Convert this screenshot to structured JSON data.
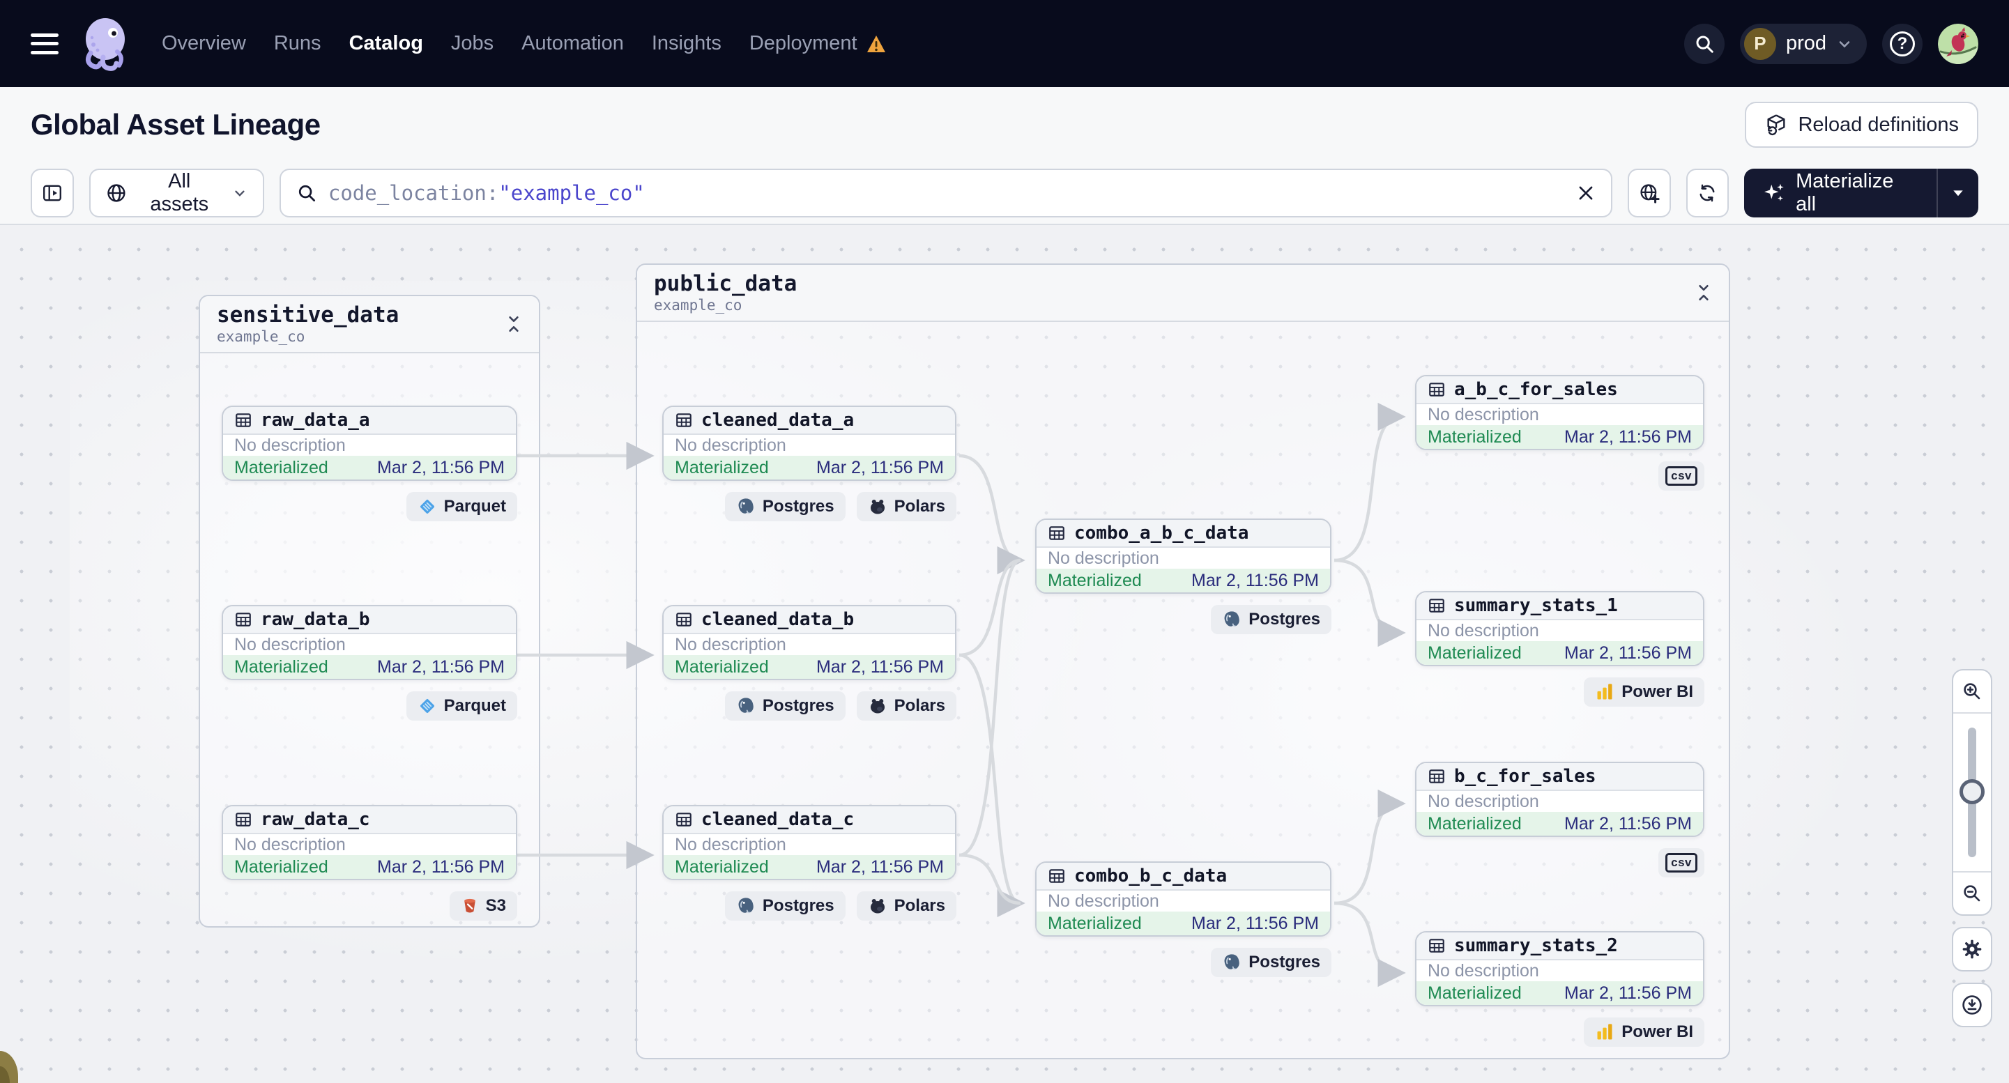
{
  "nav": {
    "items": [
      "Overview",
      "Runs",
      "Catalog",
      "Jobs",
      "Automation",
      "Insights",
      "Deployment"
    ],
    "active_item": "Catalog",
    "deployment_warning": true,
    "environment": {
      "initial": "P",
      "name": "prod"
    }
  },
  "page": {
    "title": "Global Asset Lineage",
    "reload_button_label": "Reload definitions"
  },
  "toolbar": {
    "scope_selector_label": "All assets",
    "search_tokens": [
      {
        "text": "code_location:",
        "color": "#7B83A0"
      },
      {
        "text": "\"example_co\"",
        "color": "#4A45CC"
      }
    ],
    "materialize_button_label": "Materialize all"
  },
  "graph": {
    "groups": [
      {
        "id": "sensitive_data",
        "title": "sensitive_data",
        "subtitle": "example_co"
      },
      {
        "id": "public_data",
        "title": "public_data",
        "subtitle": "example_co"
      }
    ],
    "nodes": [
      {
        "id": "raw_data_a",
        "name": "raw_data_a",
        "group": "sensitive_data",
        "description": "No description",
        "status": "Materialized",
        "timestamp": "Mar 2, 11:56 PM",
        "tags": [
          {
            "kind": "parquet",
            "label": "Parquet"
          }
        ]
      },
      {
        "id": "raw_data_b",
        "name": "raw_data_b",
        "group": "sensitive_data",
        "description": "No description",
        "status": "Materialized",
        "timestamp": "Mar 2, 11:56 PM",
        "tags": [
          {
            "kind": "parquet",
            "label": "Parquet"
          }
        ]
      },
      {
        "id": "raw_data_c",
        "name": "raw_data_c",
        "group": "sensitive_data",
        "description": "No description",
        "status": "Materialized",
        "timestamp": "Mar 2, 11:56 PM",
        "tags": [
          {
            "kind": "s3",
            "label": "S3"
          }
        ]
      },
      {
        "id": "cleaned_data_a",
        "name": "cleaned_data_a",
        "group": "public_data",
        "description": "No description",
        "status": "Materialized",
        "timestamp": "Mar 2, 11:56 PM",
        "tags": [
          {
            "kind": "postgres",
            "label": "Postgres"
          },
          {
            "kind": "polars",
            "label": "Polars"
          }
        ]
      },
      {
        "id": "cleaned_data_b",
        "name": "cleaned_data_b",
        "group": "public_data",
        "description": "No description",
        "status": "Materialized",
        "timestamp": "Mar 2, 11:56 PM",
        "tags": [
          {
            "kind": "postgres",
            "label": "Postgres"
          },
          {
            "kind": "polars",
            "label": "Polars"
          }
        ]
      },
      {
        "id": "cleaned_data_c",
        "name": "cleaned_data_c",
        "group": "public_data",
        "description": "No description",
        "status": "Materialized",
        "timestamp": "Mar 2, 11:56 PM",
        "tags": [
          {
            "kind": "postgres",
            "label": "Postgres"
          },
          {
            "kind": "polars",
            "label": "Polars"
          }
        ]
      },
      {
        "id": "combo_a_b_c_data",
        "name": "combo_a_b_c_data",
        "group": "public_data",
        "description": "No description",
        "status": "Materialized",
        "timestamp": "Mar 2, 11:56 PM",
        "tags": [
          {
            "kind": "postgres",
            "label": "Postgres"
          }
        ]
      },
      {
        "id": "combo_b_c_data",
        "name": "combo_b_c_data",
        "group": "public_data",
        "description": "No description",
        "status": "Materialized",
        "timestamp": "Mar 2, 11:56 PM",
        "tags": [
          {
            "kind": "postgres",
            "label": "Postgres"
          }
        ]
      },
      {
        "id": "a_b_c_for_sales",
        "name": "a_b_c_for_sales",
        "group": "public_data",
        "description": "No description",
        "status": "Materialized",
        "timestamp": "Mar 2, 11:56 PM",
        "tags": [
          {
            "kind": "csv",
            "label": "csv"
          }
        ]
      },
      {
        "id": "summary_stats_1",
        "name": "summary_stats_1",
        "group": "public_data",
        "description": "No description",
        "status": "Materialized",
        "timestamp": "Mar 2, 11:56 PM",
        "tags": [
          {
            "kind": "powerbi",
            "label": "Power BI"
          }
        ]
      },
      {
        "id": "b_c_for_sales",
        "name": "b_c_for_sales",
        "group": "public_data",
        "description": "No description",
        "status": "Materialized",
        "timestamp": "Mar 2, 11:56 PM",
        "tags": [
          {
            "kind": "csv",
            "label": "csv"
          }
        ]
      },
      {
        "id": "summary_stats_2",
        "name": "summary_stats_2",
        "group": "public_data",
        "description": "No description",
        "status": "Materialized",
        "timestamp": "Mar 2, 11:56 PM",
        "tags": [
          {
            "kind": "powerbi",
            "label": "Power BI"
          }
        ]
      }
    ]
  },
  "colors": {
    "status_green": "#1E8A52",
    "timestamp_blue": "#2A2C7C",
    "query_value_blue": "#4A45CC",
    "warning_orange": "#EFA43E",
    "nav_background": "#080B1C"
  }
}
